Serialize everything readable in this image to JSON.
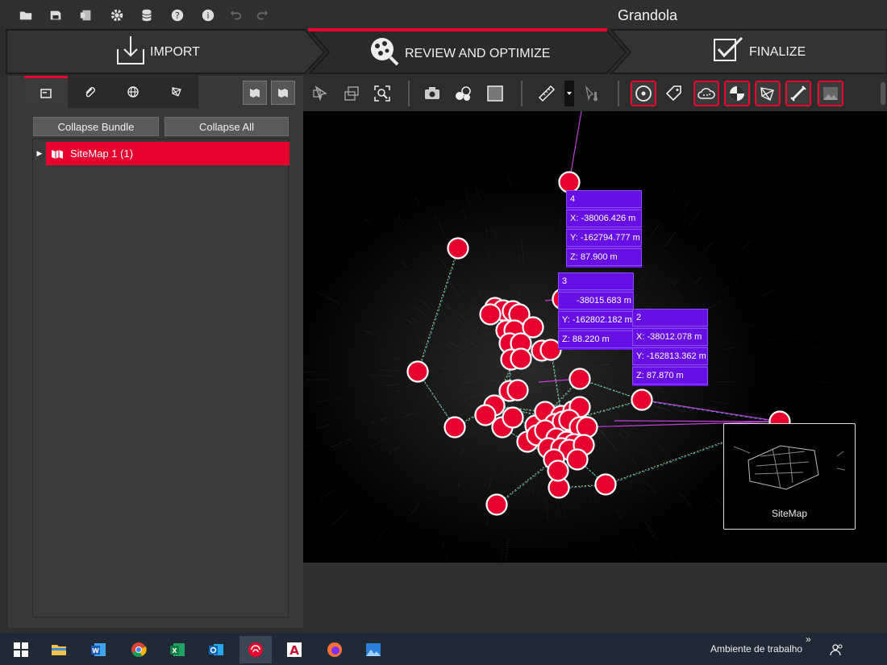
{
  "app": {
    "title": "Grandola"
  },
  "steps": [
    {
      "label": "IMPORT"
    },
    {
      "label": "REVIEW AND OPTIMIZE"
    },
    {
      "label": "FINALIZE"
    }
  ],
  "left_panel": {
    "tabs": [
      "folder-tab",
      "attachment-tab",
      "globe-tab",
      "network-tab"
    ],
    "buttons": {
      "collapse_bundle": "Collapse Bundle",
      "collapse_all": "Collapse All"
    },
    "tree": [
      {
        "label": "SiteMap 1 (1)"
      }
    ]
  },
  "info_boxes": [
    {
      "id": "4",
      "x": "X: -38006.426 m",
      "y": "Y: -162794.777 m",
      "z": "Z: 87.900 m"
    },
    {
      "id": "3",
      "x": "-38015.683 m",
      "y": "Y: -162802.182 m",
      "z": "Z: 88.220 m"
    },
    {
      "id": "2",
      "x": "X: -38012.078 m",
      "y": "Y: -162813.362 m",
      "z": "Z: 87.870 m"
    }
  ],
  "minimap": {
    "label": "SiteMap"
  },
  "taskbar": {
    "desktop_label": "Ambiente de trabalho",
    "chevron": "»"
  },
  "colors": {
    "accent": "#e8002e",
    "info": "#6610e6",
    "viewport": "#000000"
  }
}
